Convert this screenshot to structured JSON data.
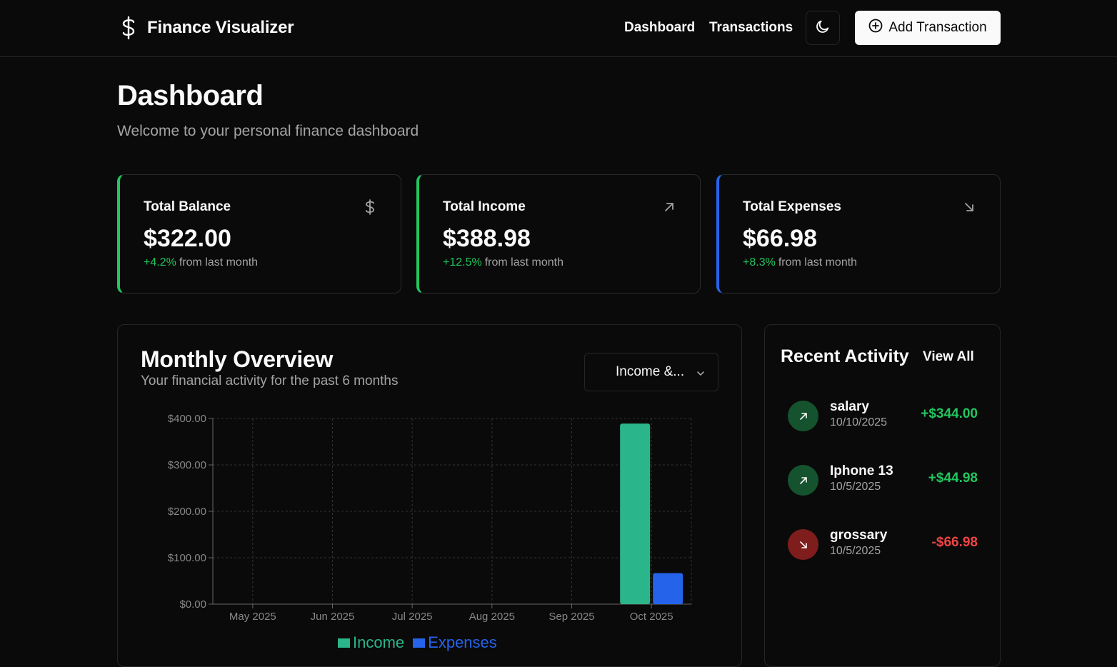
{
  "brand": {
    "title": "Finance Visualizer"
  },
  "nav": {
    "dashboard": "Dashboard",
    "transactions": "Transactions",
    "add_label": "Add Transaction"
  },
  "header": {
    "title": "Dashboard",
    "subtitle": "Welcome to your personal finance dashboard"
  },
  "cards": [
    {
      "title": "Total Balance",
      "value": "$322.00",
      "pct": "+4.2%",
      "suffix": "from last month",
      "accent": "#22c55e",
      "icon": "dollar-icon"
    },
    {
      "title": "Total Income",
      "value": "$388.98",
      "pct": "+12.5%",
      "suffix": "from last month",
      "accent": "#22c55e",
      "icon": "arrow-up-right-icon"
    },
    {
      "title": "Total Expenses",
      "value": "$66.98",
      "pct": "+8.3%",
      "suffix": "from last month",
      "accent": "#2563eb",
      "icon": "arrow-down-right-icon"
    }
  ],
  "overview": {
    "title": "Monthly Overview",
    "subtitle": "Your financial activity for the past 6 months",
    "select_value": "Income &..."
  },
  "chart_data": {
    "type": "bar",
    "categories": [
      "May 2025",
      "Jun 2025",
      "Jul 2025",
      "Aug 2025",
      "Sep 2025",
      "Oct 2025"
    ],
    "series": [
      {
        "name": "Income",
        "values": [
          0,
          0,
          0,
          0,
          0,
          388.98
        ],
        "color": "#2bb58a"
      },
      {
        "name": "Expenses",
        "values": [
          0,
          0,
          0,
          0,
          0,
          66.98
        ],
        "color": "#2563eb"
      }
    ],
    "yticks": [
      "$0.00",
      "$100.00",
      "$200.00",
      "$300.00",
      "$400.00"
    ],
    "ylim": [
      0,
      400
    ],
    "grid": true,
    "legend": "bottom"
  },
  "recent": {
    "title": "Recent Activity",
    "view_all": "View All",
    "items": [
      {
        "name": "salary",
        "date": "10/10/2025",
        "amount": "+$344.00",
        "kind": "income"
      },
      {
        "name": "Iphone 13",
        "date": "10/5/2025",
        "amount": "+$44.98",
        "kind": "income"
      },
      {
        "name": "grossary",
        "date": "10/5/2025",
        "amount": "-$66.98",
        "kind": "expense"
      }
    ]
  },
  "colors": {
    "income": "#22c55e",
    "expense": "#ef4444",
    "income_bg": "#14532d",
    "expense_bg": "#7f1d1d"
  }
}
